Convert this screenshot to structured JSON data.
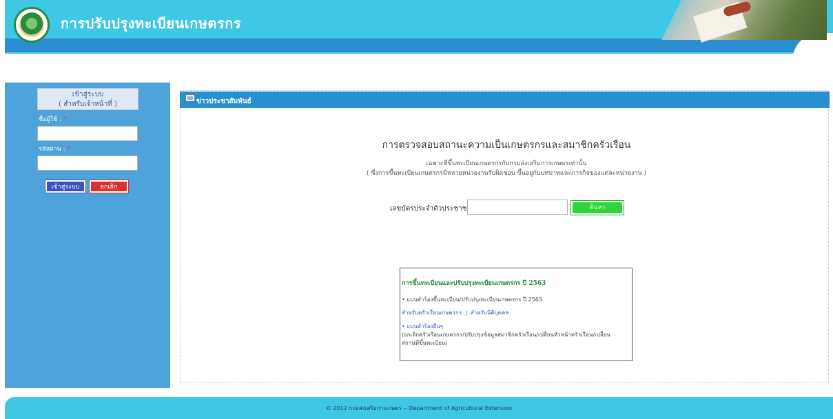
{
  "header": {
    "site_title": "การปรับปรุงทะเบียนเกษตรกร"
  },
  "sidebar": {
    "login_title_line1": "เข้าสู่ระบบ",
    "login_title_line2": "( สำหรับเจ้าหน้าที่ )",
    "username_label": "ชื่อผู้ใช้",
    "password_label": "รหัสผ่าน",
    "required_mark": "*",
    "username_value": "",
    "password_value": "",
    "login_button": "เข้าสู่ระบบ",
    "cancel_button": "ยกเลิก"
  },
  "main": {
    "news_title": "ข่าวประชาสัมพันธ์",
    "check_title": "การตรวจสอบสถานะความเป็นเกษตรกรและสมาชิกครัวเรือน",
    "check_sub1": "เฉพาะที่ขึ้นทะเบียนเกษตรกรกับกรมส่งเสริมการเกษตรเท่านั้น",
    "check_sub2": "( ซึ่งการขึ้นทะเบียนเกษตรกรมีหลายหน่วยงานรับผิดชอบ ขึ้นอยู่กับบทบาทและภารกิจของแต่ละหน่วยงาน )",
    "id_label": "เลขบัตรประจำตัวประชาชน:",
    "id_value": "",
    "search_button": "ค้นหา",
    "info": {
      "heading": "การขึ้นทะเบียนและปรับปรุงทะเบียนเกษตรกร ปี 2563",
      "line_a": "• แบบคำร้องขึ้นทะเบียน/ปรับปรุงทะเบียนเกษตรกร ปี 2563",
      "link_household": "สำหรับครัวเรือนเกษตรกร",
      "link_sep": "|",
      "link_juristic": "สำหรับนิติบุคคล",
      "line_b": "• แบบคำร้องอื่นๆ",
      "line_c": "(ยกเลิกครัวเรือนเกษตรกร/ปรับปรุงข้อมูลสมาชิกครัวเรือน/เปลี่ยนหัวหน้าครัวเรือน/เปลี่ยน",
      "line_d": "สถานที่ขึ้นทะเบียน)"
    }
  },
  "footer": {
    "text": "© 2012 กรมส่งเสริมการเกษตร -- Department of Agricultural Extension"
  },
  "colors": {
    "header_cyan": "#3fc7e6",
    "header_blue": "#2a8fd0",
    "sidebar_blue": "#4fa3db",
    "login_button": "#3e4fbf",
    "cancel_button": "#d9312b",
    "search_button": "#2fd43a",
    "heading_green": "#2e8b3e",
    "link_blue": "#2f58c4"
  },
  "icons": {
    "logo": "department-seal-icon",
    "news": "newspaper-icon"
  }
}
